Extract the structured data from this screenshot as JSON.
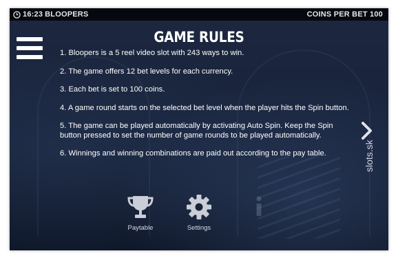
{
  "status_bar": {
    "time": "16:23",
    "game_name": "BLOOPERS",
    "coins_per_bet": "COINS PER BET 100"
  },
  "title": "GAME RULES",
  "rules": [
    "1. Bloopers is a 5 reel video slot with 243 ways to win.",
    "2. The game offers 12 bet levels for each currency.",
    "3. Each bet is set to 100 coins.",
    "4. A game round starts on the selected bet level when the player hits the Spin button.",
    "5. The game can be played automatically by activating Auto Spin. Keep the Spin button pressed to set the number of game rounds to be played automatically.",
    "6. Winnings and winning combinations are paid out according to the pay table."
  ],
  "nav": {
    "paytable_label": "Paytable",
    "settings_label": "Settings"
  },
  "icons": {
    "menu": "hamburger-menu-icon",
    "next": "chevron-right-icon",
    "paytable": "trophy-icon",
    "settings": "gear-icon",
    "info": "info-icon",
    "clock": "clock-icon"
  },
  "watermark": "slots.sk"
}
